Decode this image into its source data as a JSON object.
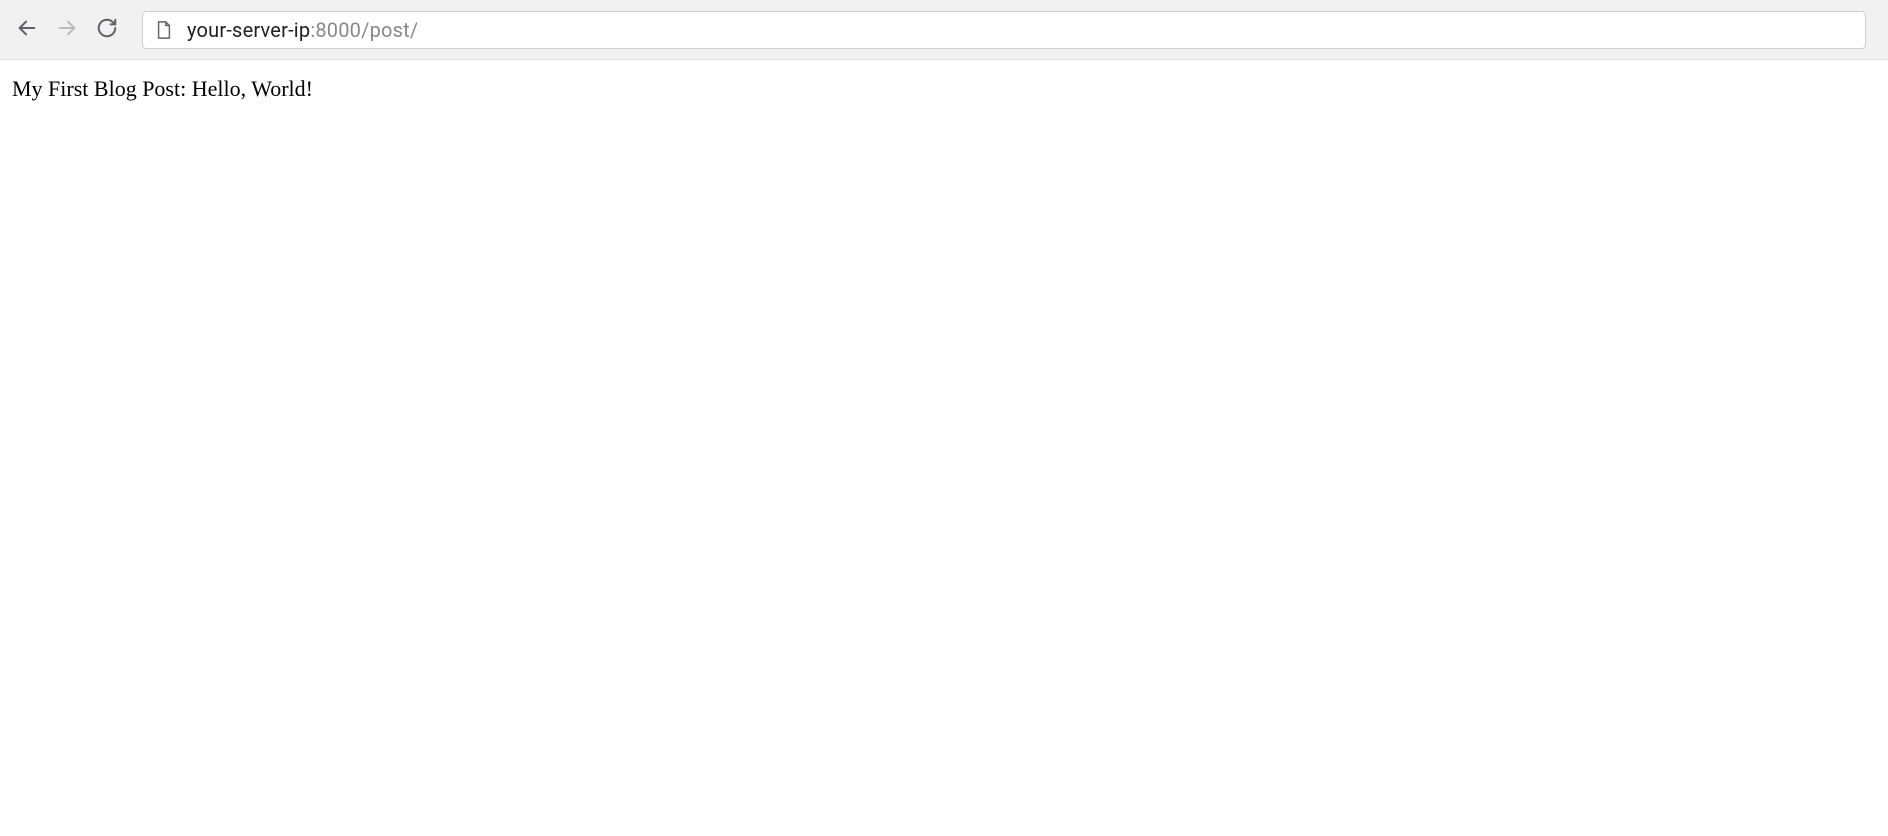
{
  "toolbar": {
    "url_host": "your-server-ip",
    "url_port_path": ":8000/post/"
  },
  "page": {
    "body_text": "My First Blog Post: Hello, World!"
  }
}
